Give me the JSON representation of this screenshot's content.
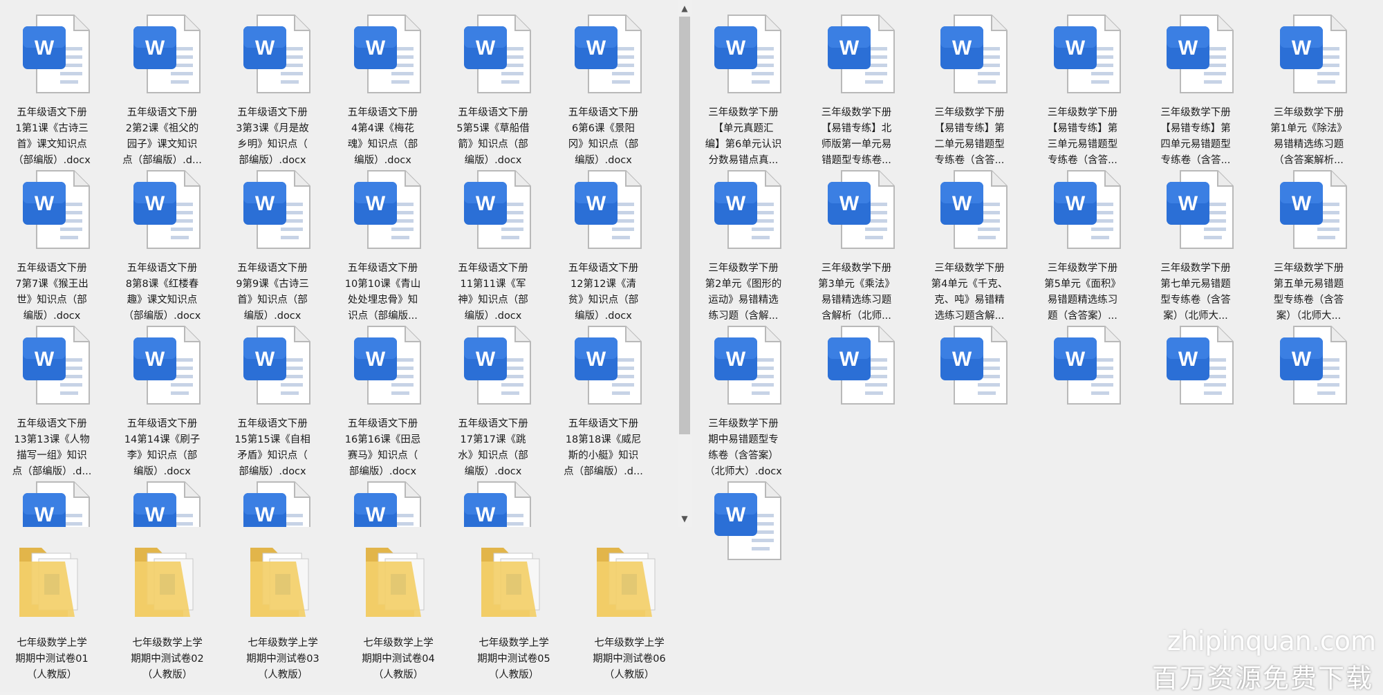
{
  "left_panel": {
    "files": [
      {
        "name": "五年级语文下册\n1第1课《古诗三\n首》课文知识点\n（部编版）.docx"
      },
      {
        "name": "五年级语文下册\n2第2课《祖父的\n园子》课文知识\n点（部编版）.d..."
      },
      {
        "name": "五年级语文下册\n3第3课《月是故\n乡明》知识点（\n部编版）.docx"
      },
      {
        "name": "五年级语文下册\n4第4课《梅花\n魂》知识点（部\n编版）.docx"
      },
      {
        "name": "五年级语文下册\n5第5课《草船借\n箭》知识点（部\n编版）.docx"
      },
      {
        "name": "五年级语文下册\n6第6课《景阳\n冈》知识点（部\n编版）.docx"
      },
      {
        "name": "五年级语文下册\n7第7课《猴王出\n世》知识点（部\n编版）.docx"
      },
      {
        "name": "五年级语文下册\n8第8课《红楼春\n趣》课文知识点\n（部编版）.docx"
      },
      {
        "name": "五年级语文下册\n9第9课《古诗三\n首》知识点（部\n编版）.docx"
      },
      {
        "name": "五年级语文下册\n10第10课《青山\n处处埋忠骨》知\n识点（部编版..."
      },
      {
        "name": "五年级语文下册\n11第11课《军\n神》知识点（部\n编版）.docx"
      },
      {
        "name": "五年级语文下册\n12第12课《清\n贫》知识点（部\n编版）.docx"
      },
      {
        "name": "五年级语文下册\n13第13课《人物\n描写一组》知识\n点（部编版）.d..."
      },
      {
        "name": "五年级语文下册\n14第14课《刷子\n李》知识点（部\n编版）.docx"
      },
      {
        "name": "五年级语文下册\n15第15课《自相\n矛盾》知识点（\n部编版）.docx"
      },
      {
        "name": "五年级语文下册\n16第16课《田忌\n赛马》知识点（\n部编版）.docx"
      },
      {
        "name": "五年级语文下册\n17第17课《跳\n水》知识点（部\n编版）.docx"
      },
      {
        "name": "五年级语文下册\n18第18课《威尼\n斯的小艇》知识\n点（部编版）.d..."
      },
      {
        "name": ""
      },
      {
        "name": ""
      },
      {
        "name": ""
      },
      {
        "name": ""
      },
      {
        "name": ""
      }
    ]
  },
  "right_panel": {
    "files": [
      {
        "name": "三年级数学下册\n【单元真题汇\n编】第6单元认识\n分数易错点真..."
      },
      {
        "name": "三年级数学下册\n【易错专练】北\n师版第一单元易\n错题型专练卷..."
      },
      {
        "name": "三年级数学下册\n【易错专练】第\n二单元易错题型\n专练卷（含答..."
      },
      {
        "name": "三年级数学下册\n【易错专练】第\n三单元易错题型\n专练卷（含答..."
      },
      {
        "name": "三年级数学下册\n【易错专练】第\n四单元易错题型\n专练卷（含答..."
      },
      {
        "name": "三年级数学下册\n第1单元《除法》\n易错精选练习题\n（含答案解析..."
      },
      {
        "name": "三年级数学下册\n第2单元《图形的\n运动》易错精选\n练习题（含解..."
      },
      {
        "name": "三年级数学下册\n第3单元《乘法》\n易错精选练习题\n含解析（北师..."
      },
      {
        "name": "三年级数学下册\n第4单元《千克、\n克、吨》易错精\n选练习题含解..."
      },
      {
        "name": "三年级数学下册\n第5单元《面积》\n易错题精选练习\n题（含答案）..."
      },
      {
        "name": "三年级数学下册\n第七单元易错题\n型专练卷（含答\n案）（北师大..."
      },
      {
        "name": "三年级数学下册\n第五单元易错题\n型专练卷（含答\n案）（北师大..."
      },
      {
        "name": "三年级数学下册\n期中易错题型专\n练卷（含答案）\n（北师大）.docx"
      },
      {
        "name": ""
      },
      {
        "name": ""
      },
      {
        "name": ""
      },
      {
        "name": ""
      },
      {
        "name": ""
      },
      {
        "name": ""
      }
    ]
  },
  "bottom_panel": {
    "folders": [
      {
        "name": "七年级数学上学\n期期中测试卷01\n（人教版）"
      },
      {
        "name": "七年级数学上学\n期期中测试卷02\n（人教版）"
      },
      {
        "name": "七年级数学上学\n期期中测试卷03\n（人教版）"
      },
      {
        "name": "七年级数学上学\n期期中测试卷04\n（人教版）"
      },
      {
        "name": "七年级数学上学\n期期中测试卷05\n（人教版）"
      },
      {
        "name": "七年级数学上学\n期期中测试卷06\n（人教版）"
      }
    ]
  },
  "watermark": {
    "site": "zhipinquan.com",
    "slogan": "百万资源免费下载"
  },
  "icons": {
    "word_letter": "W"
  },
  "colors": {
    "word_blue": "#2b6fd6",
    "folder_yellow": "#f3cf69"
  }
}
